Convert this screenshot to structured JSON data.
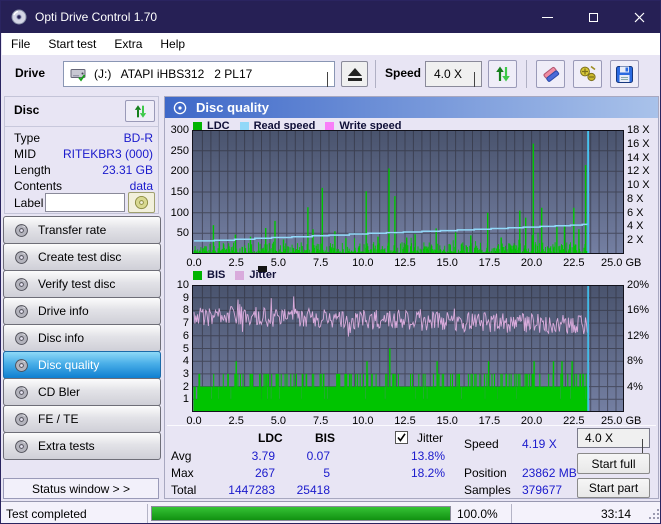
{
  "window": {
    "title": "Opti Drive Control 1.70"
  },
  "menu": {
    "items": [
      "File",
      "Start test",
      "Extra",
      "Help"
    ]
  },
  "toolbar": {
    "drive_label": "Drive",
    "drive_value": "(J:)   ATAPI iHBS312   2 PL17",
    "speed_label": "Speed",
    "speed_value": "4.0 X"
  },
  "icons": {
    "app-icon": "cd-disc",
    "drive-icon": "disk-drive",
    "eject-icon": "eject-triangle",
    "refresh-icon": "green-double-arrows",
    "erase-icon": "eraser",
    "tools-icon": "yellow-screws",
    "save-icon": "blue-floppy",
    "sidebar-disc-icon": "gray-cd",
    "label-disc-icon": "yellow-cd",
    "grip-icon": "resize-dots"
  },
  "disc_panel": {
    "title": "Disc",
    "rows": [
      {
        "label": "Type",
        "value": "BD-R"
      },
      {
        "label": "MID",
        "value": "RITEKBR3 (000)"
      },
      {
        "label": "Length",
        "value": "23.31 GB"
      },
      {
        "label": "Contents",
        "value": "data"
      }
    ],
    "label_field": {
      "label": "Label",
      "value": ""
    }
  },
  "sidebar": {
    "buttons": [
      {
        "label": "Transfer rate",
        "selected": false
      },
      {
        "label": "Create test disc",
        "selected": false
      },
      {
        "label": "Verify test disc",
        "selected": false
      },
      {
        "label": "Drive info",
        "selected": false
      },
      {
        "label": "Disc info",
        "selected": false
      },
      {
        "label": "Disc quality",
        "selected": true
      },
      {
        "label": "CD Bler",
        "selected": false
      },
      {
        "label": "FE / TE",
        "selected": false
      },
      {
        "label": "Extra tests",
        "selected": false
      }
    ],
    "status_button": "Status window > >"
  },
  "main": {
    "header": "Disc quality",
    "legend1": [
      {
        "label": "LDC",
        "color": "#00b400"
      },
      {
        "label": "Read speed",
        "color": "#92d8f8"
      },
      {
        "label": "Write speed",
        "color": "#f87ef8"
      }
    ],
    "legend2": [
      {
        "label": "BIS",
        "color": "#00b400"
      },
      {
        "label": "Jitter",
        "color": "#d9abdc"
      }
    ]
  },
  "stats": {
    "col_ldc": "LDC",
    "col_bis": "BIS",
    "jitter_label": "Jitter",
    "jitter_checked": true,
    "rows": [
      {
        "label": "Avg",
        "ldc": "3.79",
        "bis": "0.07",
        "jitter": "13.8%"
      },
      {
        "label": "Max",
        "ldc": "267",
        "bis": "5",
        "jitter": "18.2%"
      },
      {
        "label": "Total",
        "ldc": "1447283",
        "bis": "25418",
        "jitter": ""
      }
    ],
    "speed_label": "Speed",
    "speed_value": "4.19 X",
    "position_label": "Position",
    "position_value": "23862 MB",
    "samples_label": "Samples",
    "samples_value": "379677"
  },
  "controls": {
    "speed_select": "4.0 X",
    "start_full": "Start full",
    "start_part": "Start part"
  },
  "statusbar": {
    "text": "Test completed",
    "percent_label": "100.0%",
    "percent_value": 100,
    "time": "33:14"
  },
  "chart_data": [
    {
      "type": "area",
      "title": "LDC / Read speed / Write speed vs position",
      "xlabel": "GB",
      "xlim": [
        0,
        25
      ],
      "xticks": [
        "0.0",
        "2.5",
        "5.0",
        "7.5",
        "10.0",
        "12.5",
        "15.0",
        "17.5",
        "20.0",
        "22.5",
        "25.0 GB"
      ],
      "ylim_left": [
        0,
        300
      ],
      "yticks_left": [
        "300",
        "250",
        "200",
        "150",
        "100",
        "50"
      ],
      "ylim_right_speed_x": [
        0,
        18
      ],
      "yticks_right": [
        "18 X",
        "16 X",
        "14 X",
        "12 X",
        "10 X",
        "8 X",
        "6 X",
        "4 X",
        "2 X"
      ],
      "grid": true,
      "legend_position": "top-left",
      "data_end_gb": 23.35,
      "series": [
        {
          "name": "LDC",
          "style": "spikes",
          "color": "#00c400",
          "baseline_range": [
            2,
            35
          ],
          "spikes": [
            [
              1.15,
              70
            ],
            [
              1.5,
              30
            ],
            [
              2.45,
              47
            ],
            [
              3.35,
              42
            ],
            [
              4.25,
              63
            ],
            [
              4.8,
              80
            ],
            [
              5.3,
              35
            ],
            [
              6.75,
              113
            ],
            [
              7.05,
              60
            ],
            [
              7.6,
              160
            ],
            [
              8.35,
              55
            ],
            [
              9.0,
              38
            ],
            [
              10.2,
              152
            ],
            [
              10.9,
              42
            ],
            [
              11.55,
              207
            ],
            [
              11.9,
              140
            ],
            [
              12.6,
              40
            ],
            [
              13.1,
              48
            ],
            [
              14.35,
              62
            ],
            [
              15.5,
              52
            ],
            [
              16.4,
              45
            ],
            [
              17.4,
              100
            ],
            [
              18.2,
              40
            ],
            [
              19.3,
              105
            ],
            [
              19.65,
              88
            ],
            [
              20.1,
              267
            ],
            [
              20.6,
              112
            ],
            [
              21.5,
              65
            ],
            [
              21.95,
              70
            ],
            [
              22.5,
              112
            ],
            [
              22.8,
              60
            ],
            [
              23.2,
              215
            ]
          ]
        },
        {
          "name": "Read speed",
          "style": "step-line",
          "color": "#92d8f8",
          "unit": "X",
          "points": [
            [
              0,
              1.9
            ],
            [
              1.2,
              2.0
            ],
            [
              2.4,
              2.15
            ],
            [
              3.6,
              2.3
            ],
            [
              4.6,
              2.4
            ],
            [
              5.8,
              2.5
            ],
            [
              7.0,
              2.65
            ],
            [
              8.0,
              2.75
            ],
            [
              9.2,
              2.9
            ],
            [
              10.3,
              3.0
            ],
            [
              11.4,
              3.1
            ],
            [
              12.4,
              3.2
            ],
            [
              13.5,
              3.3
            ],
            [
              14.6,
              3.4
            ],
            [
              15.6,
              3.5
            ],
            [
              16.6,
              3.6
            ],
            [
              17.6,
              3.7
            ],
            [
              18.6,
              3.8
            ],
            [
              19.5,
              3.9
            ],
            [
              20.5,
              4.0
            ],
            [
              21.4,
              4.1
            ],
            [
              22.3,
              4.2
            ],
            [
              23.0,
              4.3
            ],
            [
              23.33,
              4.35
            ],
            [
              23.35,
              18
            ]
          ]
        },
        {
          "name": "Write speed",
          "style": "line",
          "color": "#f87ef8",
          "points": []
        }
      ]
    },
    {
      "type": "bar",
      "title": "BIS / Jitter vs position",
      "xlabel": "GB",
      "xlim": [
        0,
        25
      ],
      "xticks": [
        "0.0",
        "2.5",
        "5.0",
        "7.5",
        "10.0",
        "12.5",
        "15.0",
        "17.5",
        "20.0",
        "22.5",
        "25.0 GB"
      ],
      "ylim_left": [
        0,
        10
      ],
      "yticks_left": [
        "10",
        "9",
        "8",
        "7",
        "6",
        "5",
        "4",
        "3",
        "2",
        "1"
      ],
      "ylim_right_percent": [
        0,
        20
      ],
      "yticks_right": [
        "20%",
        "16%",
        "12%",
        "8%",
        "4%"
      ],
      "grid": true,
      "legend_position": "top-left",
      "data_end_gb": 23.35,
      "series": [
        {
          "name": "BIS",
          "style": "bars",
          "color": "#00c400",
          "typical_value": 2,
          "spikes": [
            [
              0.3,
              3
            ],
            [
              2.5,
              4
            ],
            [
              10.25,
              4
            ],
            [
              11.6,
              5
            ],
            [
              14.4,
              4
            ],
            [
              17.45,
              4
            ],
            [
              20.15,
              4
            ],
            [
              21.3,
              4
            ],
            [
              21.8,
              4
            ],
            [
              22.4,
              4
            ]
          ]
        },
        {
          "name": "Jitter",
          "style": "noisy-line",
          "color": "#d9abdc",
          "avg_percent": 13.8,
          "max_percent": 18.2,
          "band_percent": [
            12,
            17
          ]
        }
      ]
    }
  ]
}
